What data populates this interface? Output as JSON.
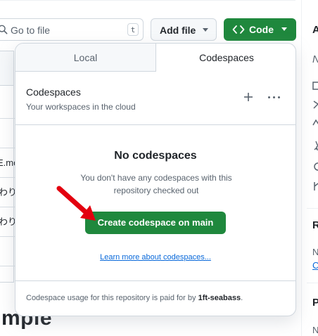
{
  "toolbar": {
    "search_placeholder": "Go to file",
    "search_shortcut": "t",
    "add_file_label": "Add file",
    "code_label": "Code"
  },
  "background": {
    "list_fragments": [
      "E.mo",
      "わり",
      "わり"
    ],
    "heading_fragment": "mple"
  },
  "sidebar_fragments": {
    "a": "A",
    "n": "N",
    "r": "R",
    "n2": "N",
    "c": "C",
    "p": "P",
    "n3": "N"
  },
  "dropdown": {
    "tabs": [
      {
        "label": "Local",
        "selected": false
      },
      {
        "label": "Codespaces",
        "selected": true
      }
    ],
    "codespaces": {
      "title": "Codespaces",
      "subtitle": "Your workspaces in the cloud",
      "add_icon": "plus-icon",
      "more_icon": "kebab-horizontal-icon"
    },
    "empty_state": {
      "title": "No codespaces",
      "description": "You don't have any codespaces with this repository checked out",
      "create_button": "Create codespace on main",
      "learn_more": "Learn more about codespaces..."
    },
    "footer": {
      "text_prefix": "Codespace usage for this repository is paid for by ",
      "payer": "1ft-seabass",
      "text_suffix": "."
    }
  },
  "colors": {
    "primary_green": "#1f883d",
    "link_blue": "#0969da",
    "border": "#d0d7de",
    "muted_text": "#59636e",
    "annotation_arrow": "#e3000f"
  }
}
